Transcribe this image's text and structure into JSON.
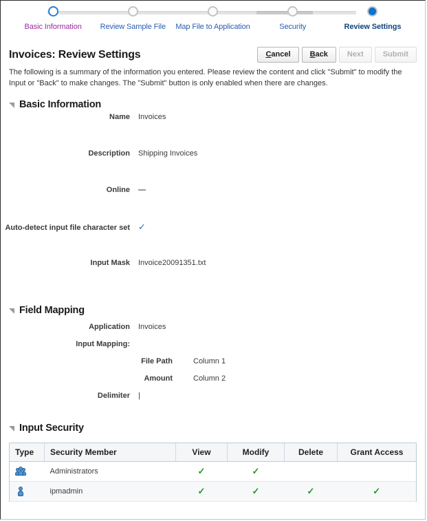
{
  "train": {
    "stops": [
      {
        "label": "Basic Information",
        "state": "visited"
      },
      {
        "label": "Review Sample File",
        "state": "pending"
      },
      {
        "label": "Map File to Application",
        "state": "pending"
      },
      {
        "label": "Security",
        "state": "pending"
      },
      {
        "label": "Review Settings",
        "state": "current"
      }
    ]
  },
  "header": {
    "title": "Invoices: Review Settings",
    "intro": "The following is a summary of the information you entered. Please review the content and click \"Submit\" to modify the Input or \"Back\" to make changes. The \"Submit\" button is only enabled when there are changes.",
    "buttons": [
      {
        "label": "Cancel",
        "accesskey": "C",
        "disabled": false
      },
      {
        "label": "Back",
        "accesskey": "B",
        "disabled": false
      },
      {
        "label": "Next",
        "accesskey": "",
        "disabled": true
      },
      {
        "label": "Submit",
        "accesskey": "",
        "disabled": true
      }
    ]
  },
  "sections": {
    "basic_information": {
      "title": "Basic Information",
      "fields": [
        {
          "label": "Name",
          "value": "Invoices",
          "type": "text"
        },
        {
          "label": "Description",
          "value": "Shipping Invoices",
          "type": "text"
        },
        {
          "label": "Online",
          "value": "",
          "type": "dash"
        },
        {
          "label": "Auto-detect input file character set",
          "value": "✓",
          "type": "check"
        },
        {
          "label": "Input Mask",
          "value": "Invoice20091351.txt",
          "type": "text"
        }
      ]
    },
    "field_mapping": {
      "title": "Field Mapping",
      "application_label": "Application",
      "application_value": "Invoices",
      "input_mapping_label": "Input Mapping:",
      "mappings": [
        {
          "source": "File Path",
          "target": "Column 1"
        },
        {
          "source": "Amount",
          "target": "Column 2"
        }
      ],
      "delimiter_label": "Delimiter",
      "delimiter_value": "|"
    },
    "input_security": {
      "title": "Input Security",
      "columns": [
        "Type",
        "Security Member",
        "View",
        "Modify",
        "Delete",
        "Grant Access"
      ],
      "rows": [
        {
          "icon": "group-icon",
          "member": "Administrators",
          "view": "✓",
          "modify": "✓",
          "delete": "",
          "grant_access": ""
        },
        {
          "icon": "user-icon",
          "member": "ipmadmin",
          "view": "✓",
          "modify": "✓",
          "delete": "✓",
          "grant_access": "✓"
        }
      ]
    }
  },
  "colors": {
    "accent_blue": "#0a73d4",
    "visited_link": "#9c2ca0",
    "link": "#2a5db0",
    "current_label": "#11447f",
    "check_green": "#1f9a1f",
    "check_blue": "#2a6fc4"
  }
}
